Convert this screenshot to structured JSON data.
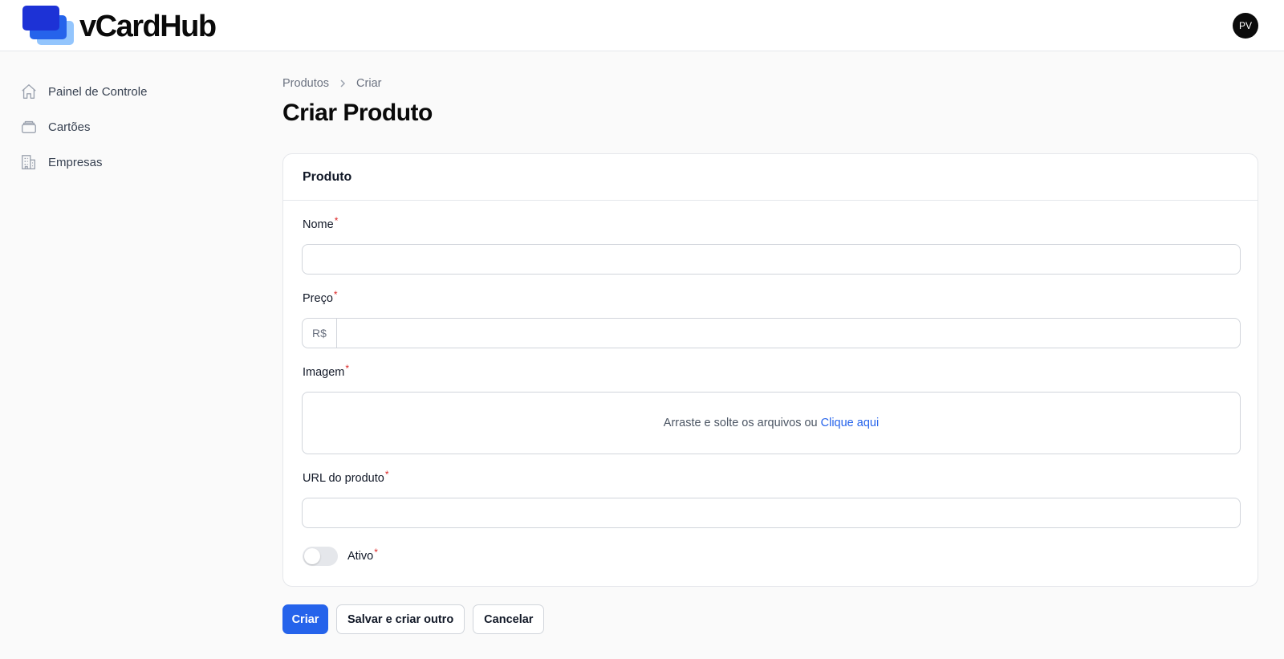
{
  "app": {
    "name": "vCardHub",
    "user_initials": "PV"
  },
  "sidebar": {
    "items": [
      {
        "label": "Painel de Controle",
        "icon": "home-icon"
      },
      {
        "label": "Cartões",
        "icon": "cards-icon"
      },
      {
        "label": "Empresas",
        "icon": "building-icon"
      }
    ]
  },
  "breadcrumb": {
    "items": [
      "Produtos",
      "Criar"
    ]
  },
  "page": {
    "title": "Criar Produto"
  },
  "form": {
    "section_title": "Produto",
    "fields": {
      "nome": {
        "label": "Nome",
        "required_mark": "*",
        "value": ""
      },
      "preco": {
        "label": "Preço",
        "required_mark": "*",
        "prefix": "R$",
        "value": ""
      },
      "imagem": {
        "label": "Imagem",
        "required_mark": "*",
        "dropzone_text": "Arraste e solte os arquivos ou",
        "dropzone_link": "Clique aqui"
      },
      "url": {
        "label": "URL do produto",
        "required_mark": "*",
        "value": ""
      },
      "ativo": {
        "label": "Ativo",
        "required_mark": "*",
        "checked": false
      }
    }
  },
  "actions": {
    "create": "Criar",
    "save_and_create_another": "Salvar e criar outro",
    "cancel": "Cancelar"
  },
  "colors": {
    "primary": "#2563eb",
    "required": "#dc2626",
    "logo_dark": "#1d32d6",
    "logo_light": "#93c5fd"
  }
}
